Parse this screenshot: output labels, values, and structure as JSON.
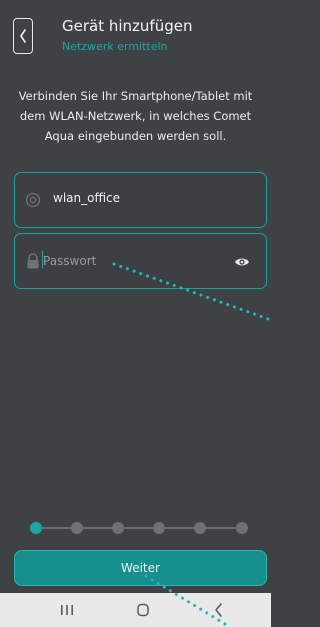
{
  "header": {
    "title": "Gerät hinzufügen",
    "subtitle": "Netzwerk ermitteln"
  },
  "intro": {
    "text": "Verbinden Sie Ihr Smartphone/Tablet mit dem WLAN-Netzwerk, in welches Comet Aqua eingebunden werden soll."
  },
  "ssid_field": {
    "icon": "at-icon",
    "value": "wlan_office"
  },
  "password_field": {
    "icon": "lock-icon",
    "placeholder": "Passwort",
    "toggle_icon": "eye-icon"
  },
  "stepper": {
    "steps": 6,
    "active_step": 1
  },
  "next_button": {
    "label": "Weiter"
  },
  "colors": {
    "background": "#3f4245",
    "accent": "#1aa7a7",
    "button": "#178f8d",
    "navbar": "#e9e9ea"
  }
}
